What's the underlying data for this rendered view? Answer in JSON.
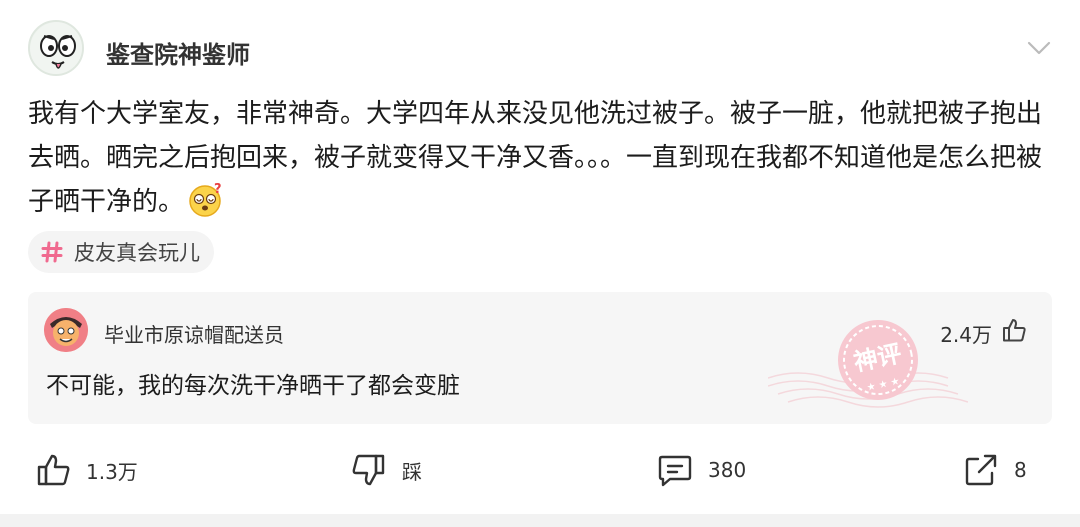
{
  "post": {
    "author": "鉴查院神鉴师",
    "content": "我有个大学室友，非常神奇。大学四年从来没见他洗过被子。被子一脏，他就把被子抱出去晒。晒完之后抱回来，被子就变得又干净又香。。。一直到现在我都不知道他是怎么把被子晒干净的。",
    "emoji": "confused-face-emoji",
    "tag": "皮友真会玩儿"
  },
  "comment": {
    "author": "毕业市原谅帽配送员",
    "text": "不可能，我的每次洗干净晒干了都会变脏",
    "likes": "2.4万",
    "stamp": "神评"
  },
  "actions": {
    "like": "1.3万",
    "dislike": "踩",
    "comments": "380",
    "share": "8"
  },
  "colors": {
    "tag_hash": "#f06a8f",
    "stamp": "#f3b5c0"
  }
}
